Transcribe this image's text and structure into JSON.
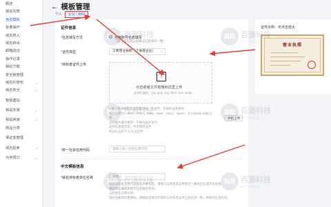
{
  "sidebar": {
    "items": [
      {
        "label": "概述",
        "chev": ""
      },
      {
        "label": "域名列表",
        "chev": ""
      },
      {
        "label": "信息模板",
        "chev": ""
      },
      {
        "label": "批量操作",
        "chev": ""
      },
      {
        "label": "域名转入",
        "chev": ""
      },
      {
        "label": "域名转出",
        "chev": ""
      },
      {
        "label": "邮箱验证",
        "chev": ""
      },
      {
        "label": "操作记录",
        "chev": ""
      },
      {
        "label": "我的下载",
        "chev": ""
      },
      {
        "label": "安全锁管理",
        "chev": ""
      },
      {
        "label": "域名托管包",
        "chev": "⌄"
      },
      {
        "label": "域名安全",
        "chev": "⌄"
      },
      {
        "label": "智能建站",
        "chev": ""
      },
      {
        "label": "我是买家",
        "chev": "⌄"
      },
      {
        "label": "我是卖家",
        "chev": "⌄"
      },
      {
        "label": "商品分类",
        "chev": ""
      },
      {
        "label": "保证金管理",
        "chev": ""
      },
      {
        "label": "域名拍卖",
        "chev": "⌄"
      },
      {
        "label": "为何预订",
        "chev": "⌄"
      }
    ]
  },
  "header": {
    "back_icon": "←",
    "title": "模板管理",
    "crumb_prefix": "个人",
    "crumb_selected": "企业 / 组织"
  },
  "form": {
    "section_cert": "证件信息",
    "label_fill_method": "信息填写方式",
    "radio_option": "使用账号信息填写",
    "radio_hint": "（提交后信息与您账号信息保持一致）",
    "label_cert_type": "证件类型",
    "cert_type_value": "工商营业执照（个体或企业）",
    "label_upload": "持有者证件上传",
    "upload_icon": "↑",
    "upload_main": "点击或者文件拖拽到这里上传",
    "upload_sub": "支持扩展名：.jpg .jpeg .png .bmp .heic .webp...",
    "upload_rules": [
      "1.请上传清晰且包含完整四角、无遮挡、无刺的证件原件",
      "格式支持为：JPG、JPEG、PNG、BMP、HEIC、WebP，大小55KB~2MB之间",
      "证件图片展示要求：不要对图片进行",
      "证件信息提交前，不可修改证件",
      "经过认证的个人/企业证件"
    ],
    "manual_button": "手机上传",
    "label_unified_code": "统一社会信用代码",
    "unified_code_placeholder": "请输入统一社会信用代码",
    "section_cn": "中文模板信息",
    "label_holder_name": "域名持有者单位名称",
    "holder_name_placeholder": "请输入",
    "holder_hint": [
      "域名持有者名称代表域名的拥有权，请填写与所有者证件完全一致的企业或单位名称。",
      "请您务必确保所填写信息真实有效，",
      "以防发生法律纠纷。",
      "域名注册和续费期间，请确保您填写的资料与持有者证件上的信息一致，并保持信息有效。"
    ]
  },
  "preview": {
    "title": "证件示例：可点击放大",
    "cert_title": "营业执照"
  },
  "watermark": {
    "logo": "BB",
    "name": "百源科技",
    "sub": "全新平台 域名信息"
  },
  "colors": {
    "accent": "#2f6bd8",
    "annotation": "#e53935"
  }
}
